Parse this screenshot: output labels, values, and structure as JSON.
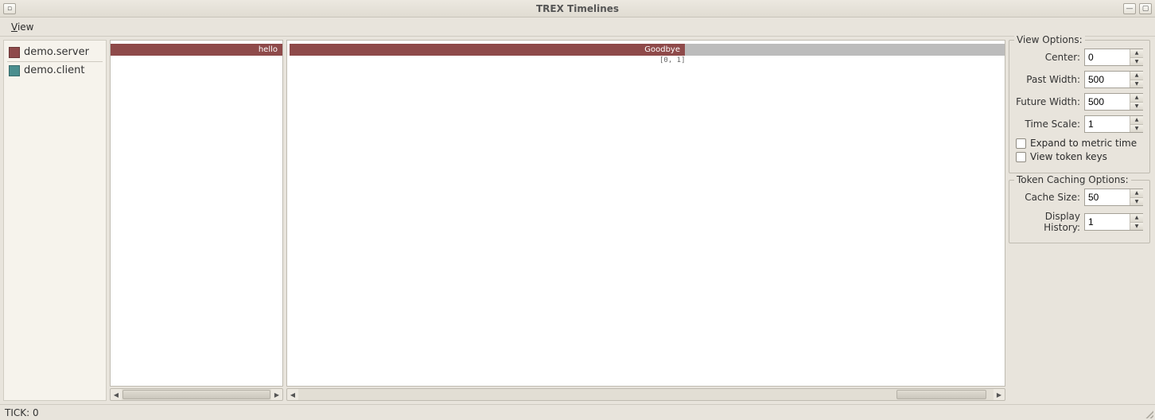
{
  "window": {
    "title": "TREX Timelines"
  },
  "menubar": {
    "view": "View"
  },
  "sidebar": {
    "items": [
      {
        "label": "demo.server",
        "color": "#8e4a4a"
      },
      {
        "label": "demo.client",
        "color": "#4a8e8e"
      }
    ]
  },
  "timeline": {
    "left_panel": {
      "token_label": "hello"
    },
    "right_panel": {
      "token_label": "Goodbye",
      "tick_range": "[0, 1]"
    }
  },
  "view_options": {
    "title": "View Options:",
    "center_label": "Center:",
    "center_value": "0",
    "past_width_label": "Past Width:",
    "past_width_value": "500",
    "future_width_label": "Future Width:",
    "future_width_value": "500",
    "time_scale_label": "Time Scale:",
    "time_scale_value": "1",
    "expand_metric_label": "Expand to metric time",
    "view_token_keys_label": "View token keys"
  },
  "token_caching": {
    "title": "Token Caching Options:",
    "cache_size_label": "Cache Size:",
    "cache_size_value": "50",
    "display_history_label": "Display History:",
    "display_history_value": "1"
  },
  "statusbar": {
    "tick": "TICK: 0"
  }
}
